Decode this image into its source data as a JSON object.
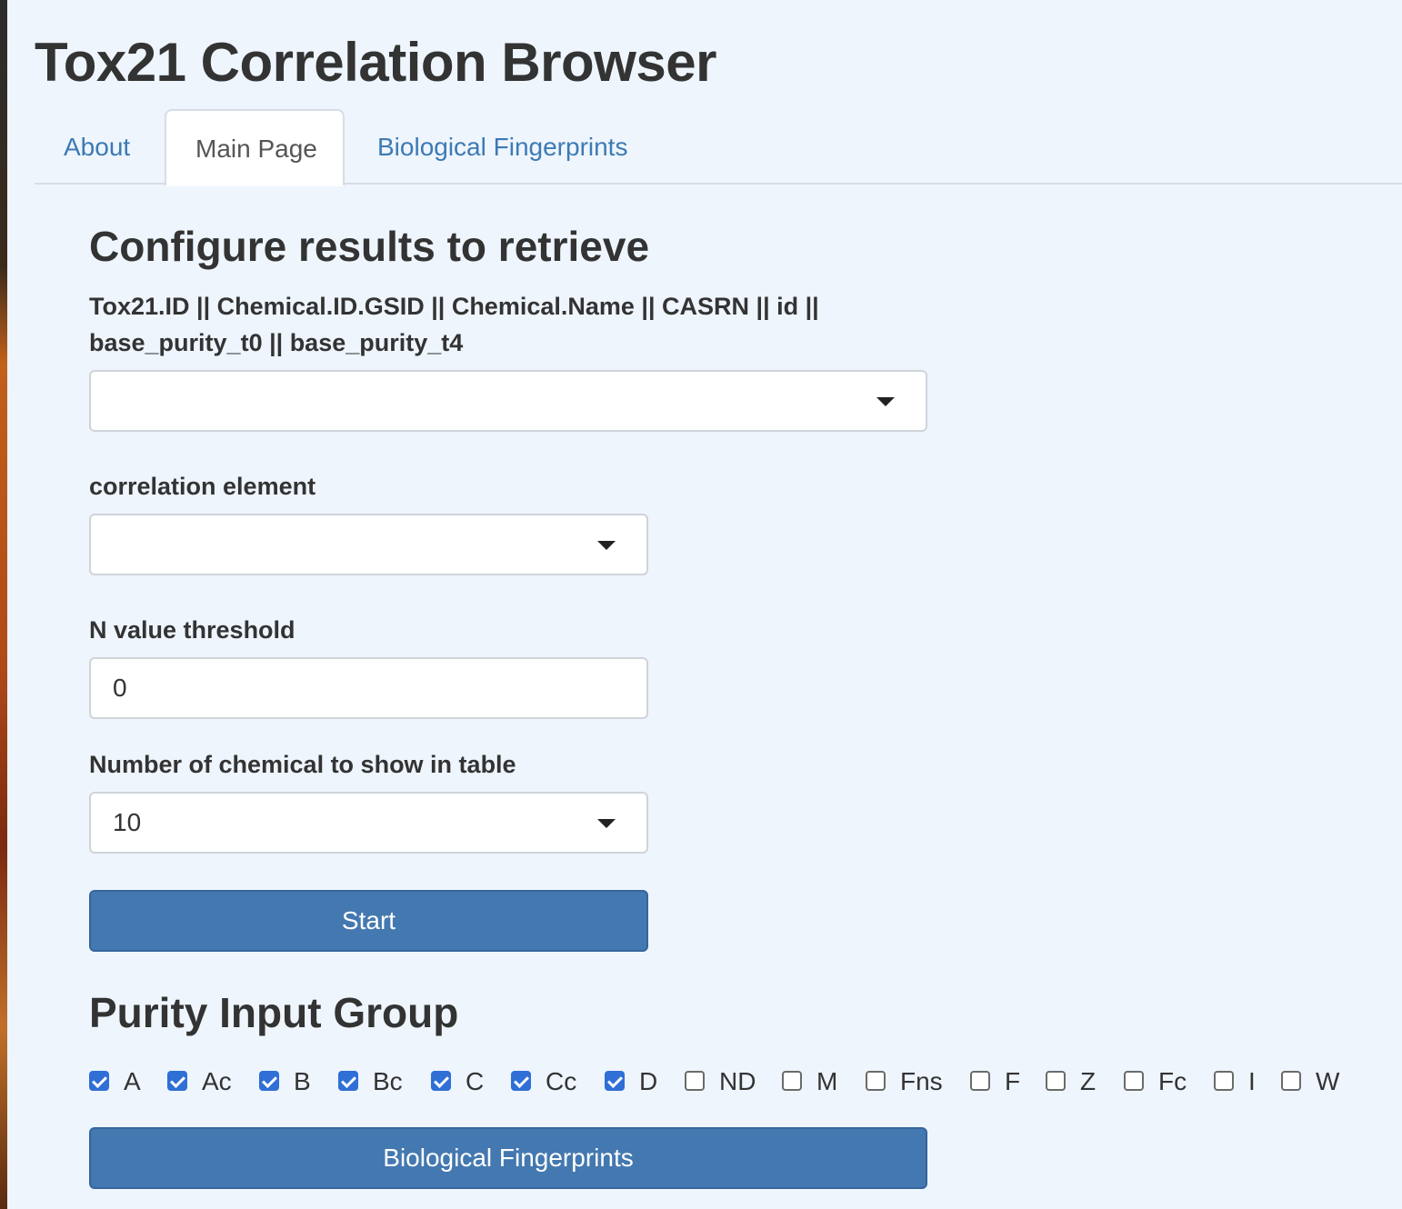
{
  "app": {
    "title": "Tox21 Correlation Browser"
  },
  "tabs": [
    {
      "label": "About",
      "active": false
    },
    {
      "label": "Main Page",
      "active": true
    },
    {
      "label": "Biological Fingerprints",
      "active": false
    }
  ],
  "configure": {
    "title": "Configure results to retrieve",
    "chemical_select": {
      "label": "Tox21.ID || Chemical.ID.GSID || Chemical.Name || CASRN || id || base_purity_t0 || base_purity_t4",
      "value": ""
    },
    "correlation_select": {
      "label": "correlation element",
      "value": ""
    },
    "n_threshold": {
      "label": "N value threshold",
      "value": "0"
    },
    "num_chemicals": {
      "label": "Number of chemical to show in table",
      "value": "10"
    },
    "start_label": "Start"
  },
  "purity": {
    "title": "Purity Input Group",
    "options": [
      {
        "label": "A",
        "checked": true
      },
      {
        "label": "Ac",
        "checked": true
      },
      {
        "label": "B",
        "checked": true
      },
      {
        "label": "Bc",
        "checked": true
      },
      {
        "label": "C",
        "checked": true
      },
      {
        "label": "Cc",
        "checked": true
      },
      {
        "label": "D",
        "checked": true
      },
      {
        "label": "ND",
        "checked": false
      },
      {
        "label": "M",
        "checked": false
      },
      {
        "label": "Fns",
        "checked": false
      },
      {
        "label": "F",
        "checked": false
      },
      {
        "label": "Z",
        "checked": false
      },
      {
        "label": "Fc",
        "checked": false
      },
      {
        "label": "I",
        "checked": false
      },
      {
        "label": "W",
        "checked": false
      }
    ],
    "fingerprints_button_label": "Biological Fingerprints"
  },
  "colors": {
    "page_background": "#eef5fd",
    "link": "#3d7ab3",
    "primary_button": "#4478b0",
    "checkbox_checked": "#2f6fd6"
  }
}
